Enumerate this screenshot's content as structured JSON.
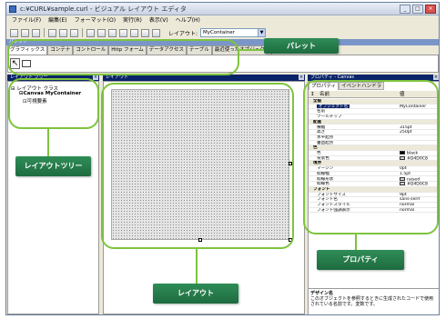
{
  "window": {
    "title": "c:¥CURL¥sample.curl - ビジュアル レイアウト エディタ",
    "controls": [
      "_",
      "□",
      "×"
    ]
  },
  "menu": [
    "ファイル(F)",
    "編集(E)",
    "フォーマット(O)",
    "実行(R)",
    "表示(V)",
    "ヘルプ(H)"
  ],
  "toolbar": {
    "layout_label": "レイアウト:",
    "layout_value": "MyContainer"
  },
  "palette": {
    "header": "パレット",
    "tabs": [
      "グラフィックス",
      "コンテナ",
      "コントロール",
      "Http フォーム",
      "データアクセス",
      "テーブル",
      "最近使ったオブジェクト"
    ]
  },
  "tree_pane": {
    "header": "レイアウト ツリー",
    "nodes": [
      "レイアウト クラス",
      "Canvas MyContainer",
      "可視要素"
    ]
  },
  "layout_pane": {
    "header": "レイアウト"
  },
  "props_pane": {
    "header": "プロパティ - Canvas",
    "tabs": [
      "プロパティ",
      "イベントハンドラ"
    ],
    "col_name": "名前",
    "col_value": "値",
    "rows": [
      {
        "name": "全般",
        "value": "",
        "cat": true
      },
      {
        "name": "オブジェクト名",
        "value": "MyContainer",
        "sel": true
      },
      {
        "name": "名前",
        "value": ""
      },
      {
        "name": "ツールチップ",
        "value": ""
      },
      {
        "name": "配置",
        "value": "",
        "cat": true
      },
      {
        "name": "横幅",
        "value": "315pt"
      },
      {
        "name": "高さ",
        "value": "250pt"
      },
      {
        "name": "水平起点",
        "value": ""
      },
      {
        "name": "垂直起点",
        "value": ""
      },
      {
        "name": "色",
        "value": "",
        "cat": true
      },
      {
        "name": "色",
        "value": "black",
        "swatch": "#000000"
      },
      {
        "name": "背景色",
        "value": "#D4D0C8",
        "swatch": "#d4d0c8"
      },
      {
        "name": "境界",
        "value": "",
        "cat": true
      },
      {
        "name": "マージン",
        "value": "0pt"
      },
      {
        "name": "枠線幅",
        "value": "1.5pt"
      },
      {
        "name": "枠線形状",
        "value": "raised",
        "swatch": "#d4d0c8"
      },
      {
        "name": "枠線色",
        "value": "#D4D0C8",
        "swatch": "#d4d0c8"
      },
      {
        "name": "フォント",
        "value": "",
        "cat": true
      },
      {
        "name": "フォントサイズ",
        "value": "9pt"
      },
      {
        "name": "フォント名",
        "value": "sans-serif"
      },
      {
        "name": "フォントスタイル",
        "value": "normal"
      },
      {
        "name": "フォント強調表示",
        "value": "normal"
      }
    ],
    "desc_title": "デザイン名",
    "desc_text": "このオブジェクトを参照するときに生成されたコードで使用されている名前です。変数です。"
  },
  "callouts": {
    "palette": "パレット",
    "tree": "レイアウトツリー",
    "layout": "レイアウト",
    "props": "プロパティ"
  }
}
